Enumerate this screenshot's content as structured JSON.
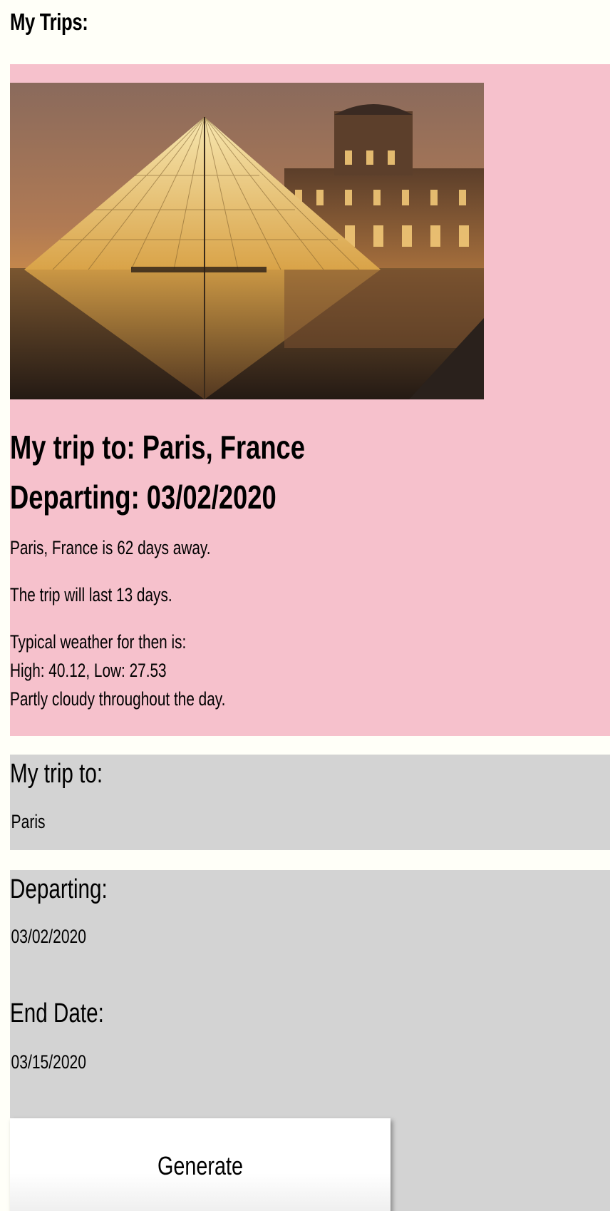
{
  "page": {
    "title": "My Trips:"
  },
  "trip_card": {
    "photo_alt": "Louvre pyramid at dusk",
    "destination_heading": "My trip to: Paris, France",
    "departing_heading": "Departing: 03/02/2020",
    "days_away_text": "Paris, France is 62 days away.",
    "length_text": "The trip will last 13 days.",
    "weather_intro": "Typical weather for then is:",
    "weather_temps": "High: 40.12, Low: 27.53",
    "weather_summary": "Partly cloudy throughout the day."
  },
  "form": {
    "destination_label": "My trip to:",
    "destination_value": "Paris",
    "departing_label": "Departing:",
    "departing_value": "03/02/2020",
    "end_date_label": "End Date:",
    "end_date_value": "03/15/2020",
    "generate_label": "Generate"
  },
  "colors": {
    "page_background": "#fffff8",
    "trip_card_background": "#f6c1cc",
    "form_background": "#d3d3d3",
    "button_background": "#ffffff"
  }
}
